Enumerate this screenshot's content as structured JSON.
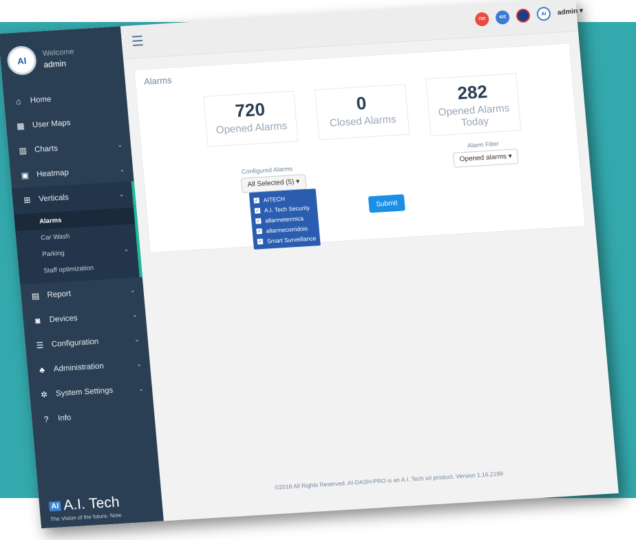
{
  "colors": {
    "teal_background": "#33a9ad",
    "sidebar": "#2a3f54",
    "accent": "#1abb9c",
    "submit": "#1a8fe3",
    "dropdown": "#2a5db0"
  },
  "header": {
    "notifications_count": "720",
    "messages_count": "432",
    "user_menu": "admin ▾",
    "avatar_text": "AI"
  },
  "sidebar": {
    "avatar_text": "AI",
    "welcome": "Welcome",
    "username": "admin",
    "items": [
      {
        "label": "Home",
        "icon": "home-icon"
      },
      {
        "label": "User Maps",
        "icon": "map-icon"
      },
      {
        "label": "Charts",
        "icon": "chart-icon"
      },
      {
        "label": "Heatmap",
        "icon": "image-icon"
      },
      {
        "label": "Verticals",
        "icon": "sitemap-icon"
      },
      {
        "label": "Report",
        "icon": "file-icon"
      },
      {
        "label": "Devices",
        "icon": "camera-icon"
      },
      {
        "label": "Configuration",
        "icon": "sliders-icon"
      },
      {
        "label": "Administration",
        "icon": "users-icon"
      },
      {
        "label": "System Settings",
        "icon": "gears-icon"
      },
      {
        "label": "Info",
        "icon": "question-icon"
      }
    ],
    "sub_items": [
      "Alarms",
      "Car Wash",
      "Parking",
      "Staff optimization"
    ],
    "brand": {
      "logo_badge": "AI",
      "logo_text": "A.I. Tech",
      "tagline": "The Vision of the future. Now."
    }
  },
  "panel": {
    "title": "Alarms",
    "stats": [
      {
        "value": "720",
        "label": "Opened Alarms"
      },
      {
        "value": "0",
        "label": "Closed Alarms"
      },
      {
        "value": "282",
        "label": "Opened Alarms Today"
      }
    ],
    "configured_label": "Configured Alarms",
    "configured_value": "All Selected (5) ▾",
    "configured_options": [
      "AITECH",
      "A.I. Tech Security",
      "allarmetermica",
      "allarmecorridoio",
      "Smart Surveillance"
    ],
    "filter_label": "Alarm Filter",
    "filter_value": "Opened alarms ▾",
    "submit_label": "Submit"
  },
  "footer": "©2018 All Rights Reserved. AI-DASH-PRO is an A.I. Tech srl product. Version 1.16.2199"
}
